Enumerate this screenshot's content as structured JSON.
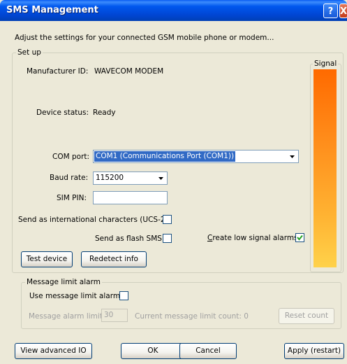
{
  "window": {
    "title": "SMS Management",
    "help_glyph": "?",
    "close_glyph": "X"
  },
  "intro": "Adjust the settings for your connected GSM mobile phone or modem...",
  "setup": {
    "legend": "Set up",
    "manufacturer_label": "Manufacturer ID:",
    "manufacturer_value": "WAVECOM MODEM",
    "device_status_label": "Device status:",
    "device_status_value": "Ready",
    "com_port_label": "COM port:",
    "com_port_value": "COM1 (Communications Port (COM1))",
    "baud_rate_label": "Baud rate:",
    "baud_rate_value": "115200",
    "sim_pin_label": "SIM PIN:",
    "sim_pin_value": "",
    "ucs2_label": "Send as international characters (UCS-2)",
    "ucs2_checked": false,
    "flash_label": "Send as flash SMS",
    "flash_checked": false,
    "low_signal_label": "Create low signal alarms",
    "low_signal_checked": true,
    "test_device_button": "Test device",
    "redetect_button": "Redetect info",
    "signal_legend": "Signal",
    "signal_level": 1.0
  },
  "message_limit": {
    "legend": "Message limit alarm",
    "use_alarm_label": "Use message limit alarm:",
    "use_alarm_checked": false,
    "alarm_limit_label": "Message alarm limit:",
    "alarm_limit_value": "30",
    "current_count_label": "Current message limit count: 0",
    "reset_button": "Reset count"
  },
  "footer": {
    "advanced_button": "View advanced IO",
    "ok_button": "OK",
    "cancel_button": "Cancel",
    "apply_button": "Apply (restart)"
  },
  "colors": {
    "title_bar": "#0058EE",
    "face": "#ECE9D8",
    "selection": "#316AC5",
    "signal_top": "#FF6A00",
    "signal_bottom": "#FFD24A"
  }
}
